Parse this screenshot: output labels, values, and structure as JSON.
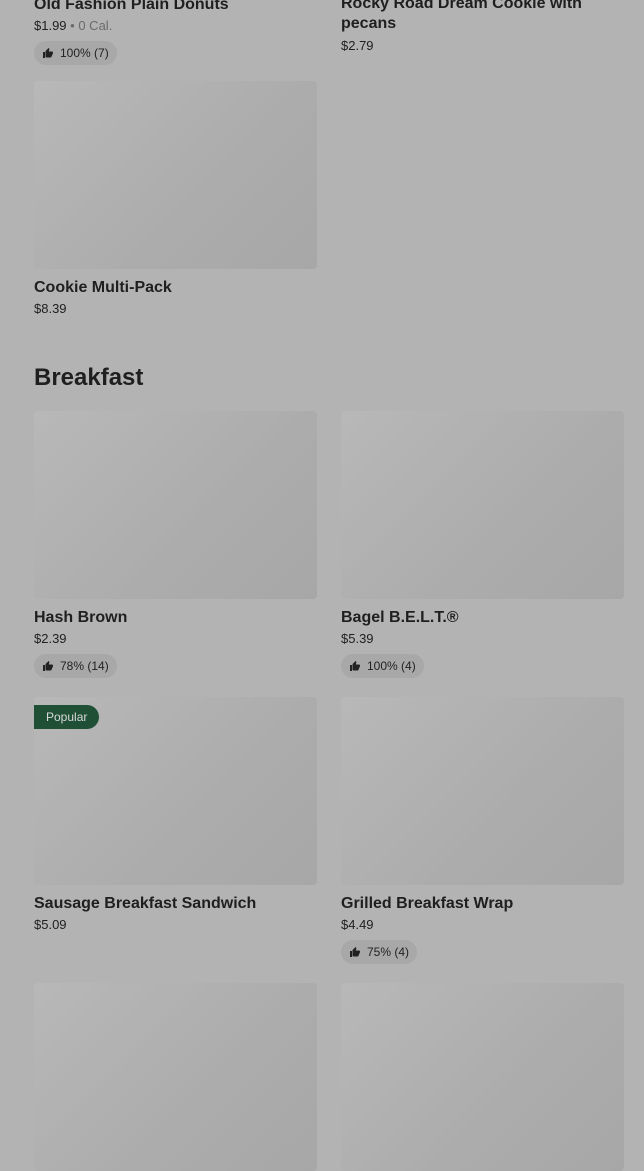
{
  "top_items": [
    {
      "title": "Old Fashion Plain Donuts",
      "price": "$1.99",
      "calories": "0 Cal.",
      "rating": "100% (7)"
    },
    {
      "title": "Rocky Road Dream Cookie with pecans",
      "price": "$2.79"
    },
    {
      "title": "Cookie Multi-Pack",
      "price": "$8.39"
    }
  ],
  "breakfast": {
    "heading": "Breakfast",
    "items": [
      {
        "title": "Hash Brown",
        "price": "$2.39",
        "rating": "78% (14)"
      },
      {
        "title": "Bagel B.E.L.T.®",
        "price": "$5.39",
        "rating": "100% (4)"
      },
      {
        "title": "Sausage Breakfast Sandwich",
        "price": "$5.09",
        "badge": "Popular"
      },
      {
        "title": "Grilled Breakfast Wrap",
        "price": "$4.49",
        "rating": "75% (4)"
      }
    ]
  },
  "icons": {
    "rating": "thumbs-up-icon"
  }
}
